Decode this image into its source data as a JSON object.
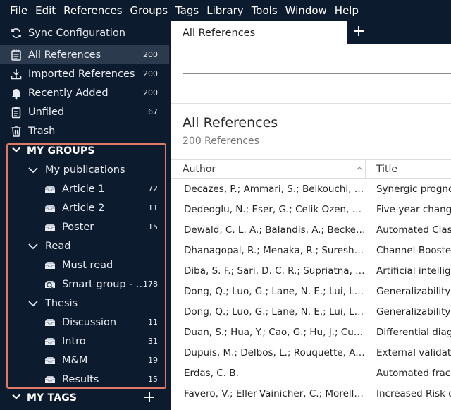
{
  "menubar": [
    "File",
    "Edit",
    "References",
    "Groups",
    "Tags",
    "Library",
    "Tools",
    "Window",
    "Help"
  ],
  "sidebar": {
    "sync": {
      "label": "Sync Configuration",
      "icon": "sync-icon"
    },
    "library": [
      {
        "label": "All References",
        "count": "200",
        "icon": "library-icon",
        "selected": true
      },
      {
        "label": "Imported References",
        "count": "200",
        "icon": "import-icon"
      },
      {
        "label": "Recently Added",
        "count": "200",
        "icon": "bell-icon"
      },
      {
        "label": "Unfiled",
        "count": "67",
        "icon": "clipboard-icon"
      },
      {
        "label": "Trash",
        "count": "",
        "icon": "trash-icon"
      }
    ],
    "my_groups_label": "MY GROUPS",
    "groups": [
      {
        "label": "My publications",
        "level": 1,
        "type": "folder"
      },
      {
        "label": "Article 1",
        "count": "72",
        "level": 2,
        "type": "group"
      },
      {
        "label": "Article 2",
        "count": "11",
        "level": 2,
        "type": "group"
      },
      {
        "label": "Poster",
        "count": "15",
        "level": 2,
        "type": "group"
      },
      {
        "label": "Read",
        "level": 1,
        "type": "folder"
      },
      {
        "label": "Must read",
        "count": "",
        "level": 2,
        "type": "group"
      },
      {
        "label": "Smart group - ...",
        "count": "178",
        "level": 2,
        "type": "smart"
      },
      {
        "label": "Thesis",
        "level": 1,
        "type": "folder"
      },
      {
        "label": "Discussion",
        "count": "11",
        "level": 2,
        "type": "group"
      },
      {
        "label": "Intro",
        "count": "31",
        "level": 2,
        "type": "group"
      },
      {
        "label": "M&M",
        "count": "19",
        "level": 2,
        "type": "group"
      },
      {
        "label": "Results",
        "count": "15",
        "level": 2,
        "type": "group"
      }
    ],
    "my_tags_label": "MY TAGS"
  },
  "main": {
    "tab_label": "All References",
    "search_placeholder": "",
    "list_title": "All References",
    "list_subtitle": "200 References",
    "columns": {
      "author": "Author",
      "title": "Title"
    },
    "rows": [
      {
        "author": "Decazes, P.; Ammari, S.; Belkouchi, Y.;...",
        "title": "Synergic progno"
      },
      {
        "author": "Dedeoglu, N.; Eser, G.; Celik Ozen, D.; ...",
        "title": "Five-year chang"
      },
      {
        "author": "Dewald, C. L. A.; Balandis, A.; Becker, ...",
        "title": "Automated Clas"
      },
      {
        "author": "Dhanagopal, R.; Menaka, R.; Suresh K...",
        "title": "Channel-Booste"
      },
      {
        "author": "Diba, S. F.; Sari, D. C. R.; Supriatna, Y.; ...",
        "title": "Artificial intellig"
      },
      {
        "author": "Dong, Q.; Luo, G.; Lane, N. E.; Lui, L. Y.;...",
        "title": "Generalizability"
      },
      {
        "author": "Dong, Q.; Luo, G.; Lane, N. E.; Lui, L. Y.;...",
        "title": "Generalizability"
      },
      {
        "author": "Duan, S.; Hua, Y.; Cao, G.; Hu, J.; Cui, ...",
        "title": "Differential diag"
      },
      {
        "author": "Dupuis, M.; Delbos, L.; Rouquette, A.; ...",
        "title": "External validati"
      },
      {
        "author": "Erdas, C. B.",
        "title": "Automated frac"
      },
      {
        "author": "Favero, V.; Eller-Vainicher, C.; Morelli, ...",
        "title": "Increased Risk o"
      }
    ]
  },
  "colors": {
    "sidebar_bg": "#0d1b2e",
    "selected_bg": "#2c3a4e",
    "groups_outline": "#e07a66"
  }
}
